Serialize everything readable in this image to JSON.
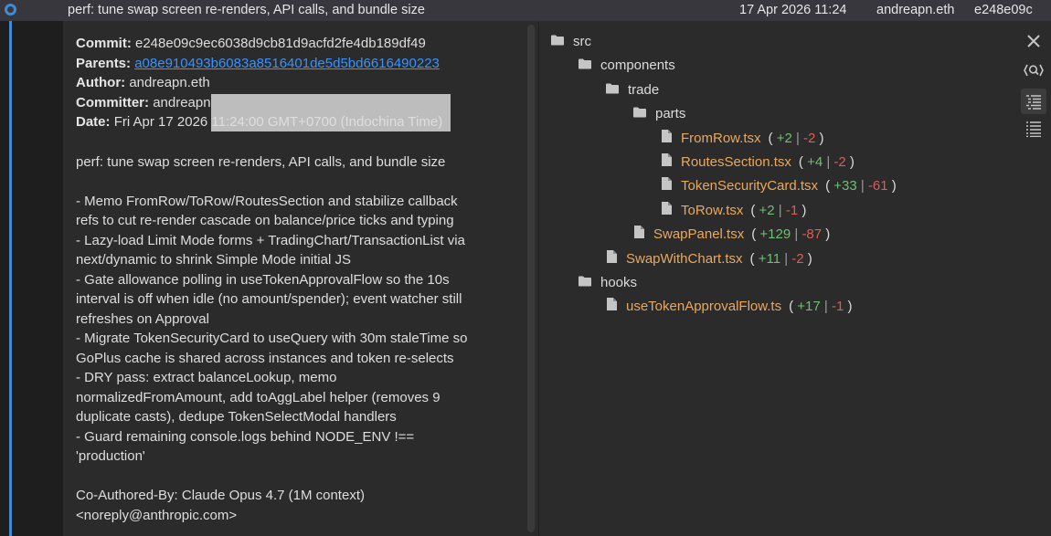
{
  "commit_row": {
    "message": "perf: tune swap screen re-renders, API calls, and bundle size",
    "date": "17 Apr 2026 11:24",
    "author": "andreapn.eth",
    "hash": "e248e09c"
  },
  "details": {
    "commit_label": "Commit:",
    "commit_value": "e248e09c9ec6038d9cb81d9acfd2fe4db189df49",
    "parents_label": "Parents:",
    "parents_value": "a08e910493b6083a8516401de5d5bd6616490223",
    "author_label": "Author:",
    "author_value": "andreapn.eth",
    "committer_label": "Committer:",
    "committer_value": "andreapn",
    "date_label": "Date:",
    "date_value": "Fri Apr 17 2026 11:24:00 GMT+0700 (Indochina Time)",
    "message_lines": [
      "perf: tune swap screen re-renders, API calls, and bundle size",
      "",
      "- Memo FromRow/ToRow/RoutesSection and stabilize callback",
      "refs to cut re-render cascade on balance/price ticks and typing",
      "- Lazy-load Limit Mode forms + TradingChart/TransactionList via",
      "next/dynamic to shrink Simple Mode initial JS",
      "- Gate allowance polling in useTokenApprovalFlow so the 10s",
      "interval is off when idle (no amount/spender); event watcher still",
      "refreshes on Approval",
      "- Migrate TokenSecurityCard to useQuery with 30m staleTime so",
      "GoPlus cache is shared across instances and token re-selects",
      "- DRY pass: extract balanceLookup, memo",
      "normalizedFromAmount, add toAggLabel helper (removes 9",
      "duplicate casts), dedupe TokenSelectModal handlers",
      "- Guard remaining console.logs behind NODE_ENV !==",
      "'production'",
      "",
      "Co-Authored-By: Claude Opus 4.7 (1M context)",
      "<noreply@anthropic.com>"
    ]
  },
  "file_tree": {
    "nodes": [
      {
        "type": "folder",
        "name": "src",
        "depth": 0
      },
      {
        "type": "folder",
        "name": "components",
        "depth": 1
      },
      {
        "type": "folder",
        "name": "trade",
        "depth": 2
      },
      {
        "type": "folder",
        "name": "parts",
        "depth": 3
      },
      {
        "type": "file",
        "name": "FromRow.tsx",
        "depth": 4,
        "added": "+2",
        "removed": "-2"
      },
      {
        "type": "file",
        "name": "RoutesSection.tsx",
        "depth": 4,
        "added": "+4",
        "removed": "-2"
      },
      {
        "type": "file",
        "name": "TokenSecurityCard.tsx",
        "depth": 4,
        "added": "+33",
        "removed": "-61"
      },
      {
        "type": "file",
        "name": "ToRow.tsx",
        "depth": 4,
        "added": "+2",
        "removed": "-1"
      },
      {
        "type": "file",
        "name": "SwapPanel.tsx",
        "depth": 3,
        "added": "+129",
        "removed": "-87"
      },
      {
        "type": "file",
        "name": "SwapWithChart.tsx",
        "depth": 2,
        "added": "+11",
        "removed": "-2"
      },
      {
        "type": "folder",
        "name": "hooks",
        "depth": 1
      },
      {
        "type": "file",
        "name": "useTokenApprovalFlow.ts",
        "depth": 2,
        "added": "+17",
        "removed": "-1"
      }
    ]
  },
  "toolbar": {
    "icons": [
      "close-icon",
      "search-regex-icon",
      "tree-view-icon",
      "list-view-icon"
    ]
  },
  "colors": {
    "graph": "#3f8bd5",
    "file_name": "#e8a860",
    "added": "#6fbf73",
    "removed": "#e05c50",
    "link": "#3794ff"
  }
}
